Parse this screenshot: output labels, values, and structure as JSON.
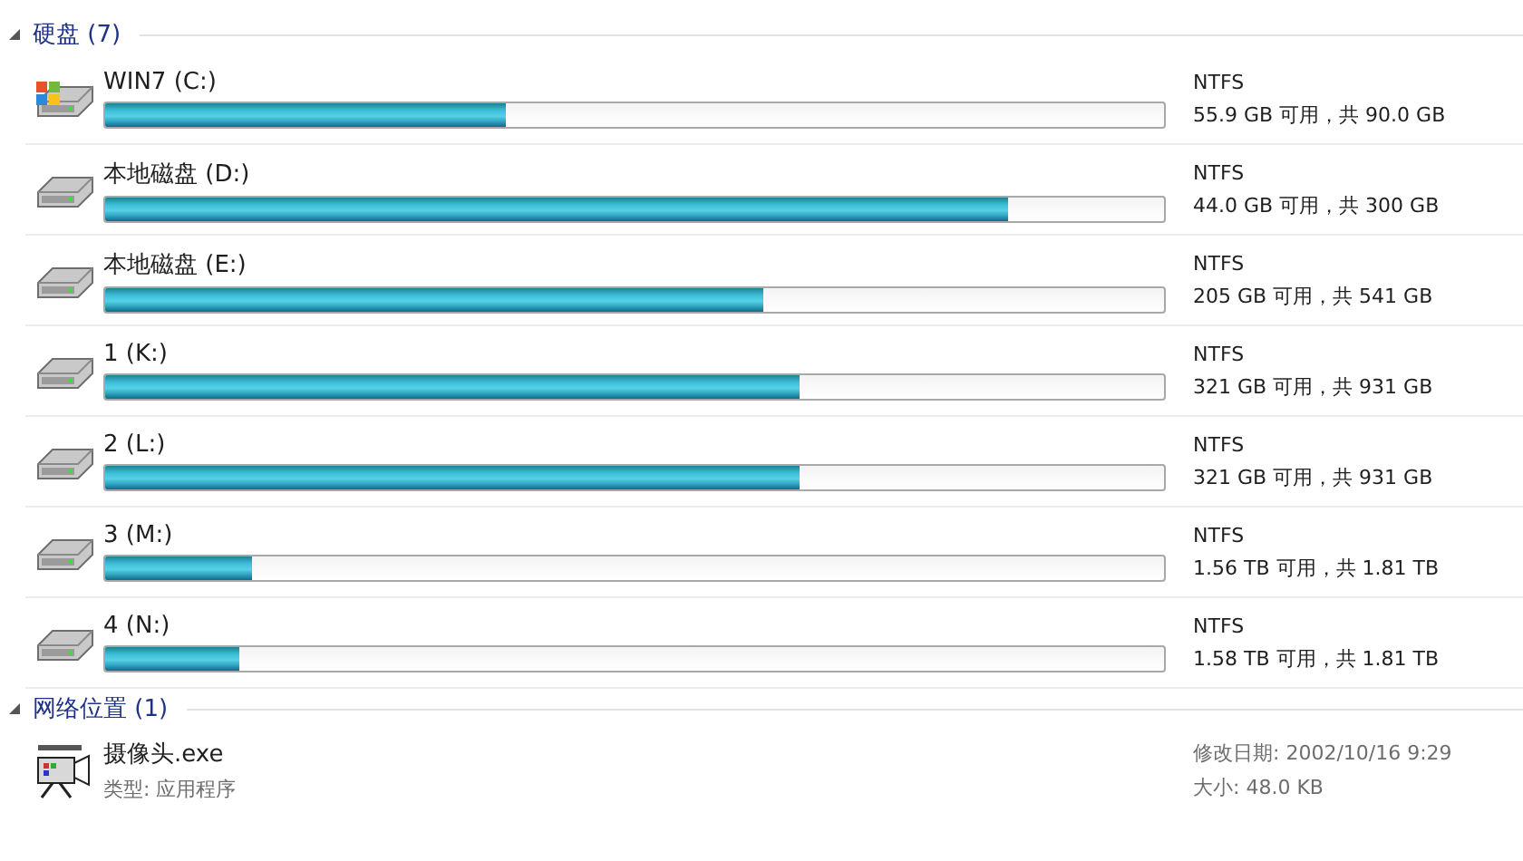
{
  "sections": [
    {
      "title": "硬盘 (7)",
      "expanded": true,
      "kind": "drives",
      "items": [
        {
          "name": "WIN7 (C:)",
          "kind": "system",
          "level": 0.379,
          "filesystem": "NTFS",
          "space": "55.9 GB 可用，共 90.0 GB"
        },
        {
          "name": "本地磁盘 (D:)",
          "kind": "disk",
          "level": 0.852,
          "filesystem": "NTFS",
          "space": "44.0 GB 可用，共 300 GB"
        },
        {
          "name": "本地磁盘 (E:)",
          "kind": "disk",
          "level": 0.621,
          "filesystem": "NTFS",
          "space": "205 GB 可用，共 541 GB"
        },
        {
          "name": "1 (K:)",
          "kind": "disk",
          "level": 0.655,
          "filesystem": "NTFS",
          "space": "321 GB 可用，共 931 GB"
        },
        {
          "name": "2 (L:)",
          "kind": "disk",
          "level": 0.655,
          "filesystem": "NTFS",
          "space": "321 GB 可用，共 931 GB"
        },
        {
          "name": "3 (M:)",
          "kind": "disk",
          "level": 0.138,
          "filesystem": "NTFS",
          "space": "1.56 TB 可用，共 1.81 TB"
        },
        {
          "name": "4 (N:)",
          "kind": "disk",
          "level": 0.127,
          "filesystem": "NTFS",
          "space": "1.58 TB 可用，共 1.81 TB"
        }
      ]
    },
    {
      "title": "网络位置 (1)",
      "expanded": true,
      "kind": "files",
      "items": [
        {
          "name": "摄像头.exe",
          "type": "类型: 应用程序",
          "modified": "修改日期: 2002/10/16 9:29",
          "size": "大小: 48.0 KB"
        }
      ]
    }
  ]
}
